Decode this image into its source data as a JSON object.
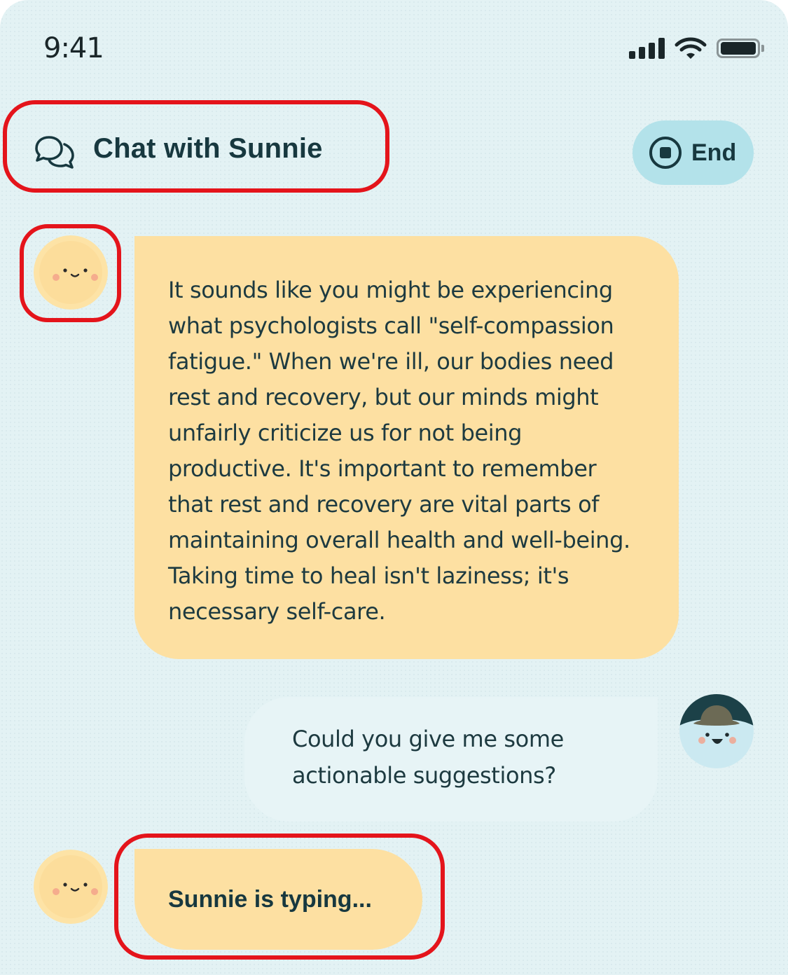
{
  "status_bar": {
    "time": "9:41",
    "icons": [
      "cellular-signal-icon",
      "wifi-icon",
      "battery-icon"
    ]
  },
  "header": {
    "title": "Chat with Sunnie",
    "title_icon": "chat-bubbles-icon",
    "end_button": {
      "label": "End",
      "icon": "stop-circle-icon"
    }
  },
  "messages": [
    {
      "sender": "bot",
      "avatar": "sunnie-avatar",
      "text": "It sounds like you might be experiencing\nwhat psychologists call \"self-compassion\nfatigue.\" When we're ill, our bodies need\nrest and recovery, but our minds might\nunfairly criticize us for not being\nproductive. It's important to remember\nthat rest and recovery are vital parts of\nmaintaining overall health and well-being.\nTaking time to heal isn't laziness; it's\nnecessary self-care."
    },
    {
      "sender": "user",
      "avatar": "user-avatar",
      "text": "Could you give me some\nactionable suggestions?"
    }
  ],
  "typing_indicator": {
    "avatar": "sunnie-avatar",
    "text": "Sunnie is typing..."
  },
  "colors": {
    "background": "#e3f2f4",
    "bot_bubble": "#fde0a2",
    "user_bubble": "#e7f4f6",
    "end_button": "#b3e2ea",
    "text_dark": "#17383f",
    "highlight_outline": "#e4141b"
  }
}
